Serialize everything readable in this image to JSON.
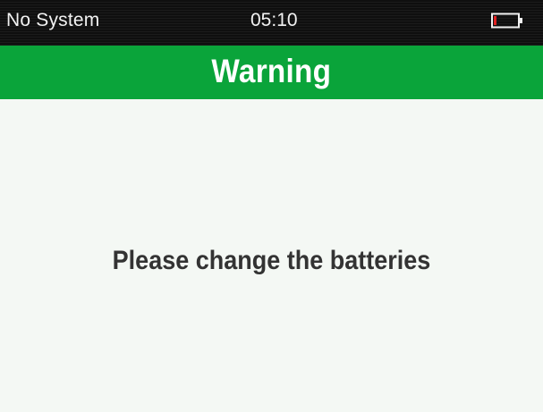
{
  "status_bar": {
    "left_text": "No System",
    "time": "05:10",
    "battery_icon": "battery-low-icon",
    "battery_level": 0.1,
    "battery_level_color": "#e02020"
  },
  "header": {
    "title": "Warning",
    "background_color": "#0aa43a"
  },
  "content": {
    "message": "Please change the batteries"
  }
}
